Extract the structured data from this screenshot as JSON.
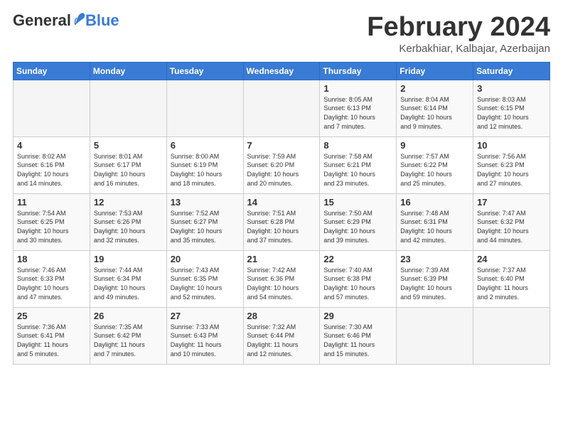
{
  "header": {
    "logo_general": "General",
    "logo_blue": "Blue",
    "month_title": "February 2024",
    "subtitle": "Kerbakhiar, Kalbajar, Azerbaijan"
  },
  "days_of_week": [
    "Sunday",
    "Monday",
    "Tuesday",
    "Wednesday",
    "Thursday",
    "Friday",
    "Saturday"
  ],
  "weeks": [
    [
      {
        "day": "",
        "info": ""
      },
      {
        "day": "",
        "info": ""
      },
      {
        "day": "",
        "info": ""
      },
      {
        "day": "",
        "info": ""
      },
      {
        "day": "1",
        "info": "Sunrise: 8:05 AM\nSunset: 6:13 PM\nDaylight: 10 hours\nand 7 minutes."
      },
      {
        "day": "2",
        "info": "Sunrise: 8:04 AM\nSunset: 6:14 PM\nDaylight: 10 hours\nand 9 minutes."
      },
      {
        "day": "3",
        "info": "Sunrise: 8:03 AM\nSunset: 6:15 PM\nDaylight: 10 hours\nand 12 minutes."
      }
    ],
    [
      {
        "day": "4",
        "info": "Sunrise: 8:02 AM\nSunset: 6:16 PM\nDaylight: 10 hours\nand 14 minutes."
      },
      {
        "day": "5",
        "info": "Sunrise: 8:01 AM\nSunset: 6:17 PM\nDaylight: 10 hours\nand 16 minutes."
      },
      {
        "day": "6",
        "info": "Sunrise: 8:00 AM\nSunset: 6:19 PM\nDaylight: 10 hours\nand 18 minutes."
      },
      {
        "day": "7",
        "info": "Sunrise: 7:59 AM\nSunset: 6:20 PM\nDaylight: 10 hours\nand 20 minutes."
      },
      {
        "day": "8",
        "info": "Sunrise: 7:58 AM\nSunset: 6:21 PM\nDaylight: 10 hours\nand 23 minutes."
      },
      {
        "day": "9",
        "info": "Sunrise: 7:57 AM\nSunset: 6:22 PM\nDaylight: 10 hours\nand 25 minutes."
      },
      {
        "day": "10",
        "info": "Sunrise: 7:56 AM\nSunset: 6:23 PM\nDaylight: 10 hours\nand 27 minutes."
      }
    ],
    [
      {
        "day": "11",
        "info": "Sunrise: 7:54 AM\nSunset: 6:25 PM\nDaylight: 10 hours\nand 30 minutes."
      },
      {
        "day": "12",
        "info": "Sunrise: 7:53 AM\nSunset: 6:26 PM\nDaylight: 10 hours\nand 32 minutes."
      },
      {
        "day": "13",
        "info": "Sunrise: 7:52 AM\nSunset: 6:27 PM\nDaylight: 10 hours\nand 35 minutes."
      },
      {
        "day": "14",
        "info": "Sunrise: 7:51 AM\nSunset: 6:28 PM\nDaylight: 10 hours\nand 37 minutes."
      },
      {
        "day": "15",
        "info": "Sunrise: 7:50 AM\nSunset: 6:29 PM\nDaylight: 10 hours\nand 39 minutes."
      },
      {
        "day": "16",
        "info": "Sunrise: 7:48 AM\nSunset: 6:31 PM\nDaylight: 10 hours\nand 42 minutes."
      },
      {
        "day": "17",
        "info": "Sunrise: 7:47 AM\nSunset: 6:32 PM\nDaylight: 10 hours\nand 44 minutes."
      }
    ],
    [
      {
        "day": "18",
        "info": "Sunrise: 7:46 AM\nSunset: 6:33 PM\nDaylight: 10 hours\nand 47 minutes."
      },
      {
        "day": "19",
        "info": "Sunrise: 7:44 AM\nSunset: 6:34 PM\nDaylight: 10 hours\nand 49 minutes."
      },
      {
        "day": "20",
        "info": "Sunrise: 7:43 AM\nSunset: 6:35 PM\nDaylight: 10 hours\nand 52 minutes."
      },
      {
        "day": "21",
        "info": "Sunrise: 7:42 AM\nSunset: 6:36 PM\nDaylight: 10 hours\nand 54 minutes."
      },
      {
        "day": "22",
        "info": "Sunrise: 7:40 AM\nSunset: 6:38 PM\nDaylight: 10 hours\nand 57 minutes."
      },
      {
        "day": "23",
        "info": "Sunrise: 7:39 AM\nSunset: 6:39 PM\nDaylight: 10 hours\nand 59 minutes."
      },
      {
        "day": "24",
        "info": "Sunrise: 7:37 AM\nSunset: 6:40 PM\nDaylight: 11 hours\nand 2 minutes."
      }
    ],
    [
      {
        "day": "25",
        "info": "Sunrise: 7:36 AM\nSunset: 6:41 PM\nDaylight: 11 hours\nand 5 minutes."
      },
      {
        "day": "26",
        "info": "Sunrise: 7:35 AM\nSunset: 6:42 PM\nDaylight: 11 hours\nand 7 minutes."
      },
      {
        "day": "27",
        "info": "Sunrise: 7:33 AM\nSunset: 6:43 PM\nDaylight: 11 hours\nand 10 minutes."
      },
      {
        "day": "28",
        "info": "Sunrise: 7:32 AM\nSunset: 6:44 PM\nDaylight: 11 hours\nand 12 minutes."
      },
      {
        "day": "29",
        "info": "Sunrise: 7:30 AM\nSunset: 6:46 PM\nDaylight: 11 hours\nand 15 minutes."
      },
      {
        "day": "",
        "info": ""
      },
      {
        "day": "",
        "info": ""
      }
    ]
  ]
}
